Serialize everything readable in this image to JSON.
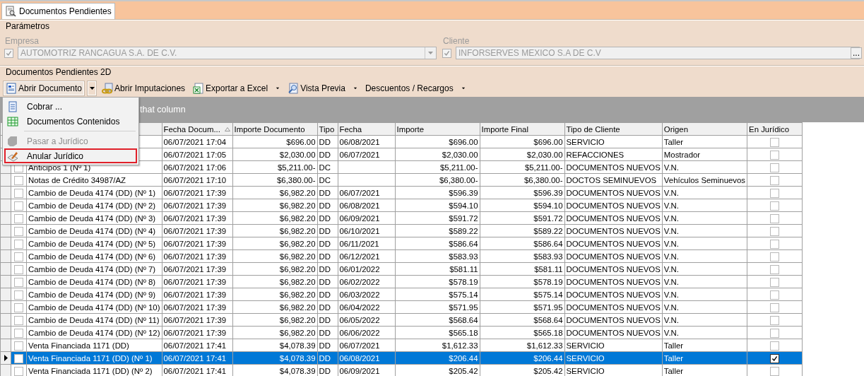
{
  "tab": {
    "title": "Documentos Pendientes",
    "selected": true
  },
  "parametros": {
    "title": "Parámetros",
    "empresa": {
      "label": "Empresa",
      "checked": true,
      "disabled": true,
      "value": "AUTOMOTRIZ RANCAGUA S.A. DE C.V."
    },
    "cliente": {
      "label": "Cliente",
      "checked": true,
      "disabled": true,
      "value": "INFORSERVES MEXICO S.A DE C.V",
      "browse_button": "..."
    }
  },
  "section_title": "Documentos Pendientes 2D",
  "toolbar": [
    {
      "kind": "doc",
      "label": "Abrir Documento",
      "split": true,
      "pressed": true
    },
    {
      "kind": "link",
      "label": "Abrir Imputaciones",
      "split": false,
      "pressed": false
    },
    {
      "kind": "excel",
      "label": "Exportar a Excel",
      "dropdown": true,
      "pressed": false
    },
    {
      "kind": "preview",
      "label": "Vista Previa",
      "dropdown": true,
      "pressed": false
    },
    {
      "kind": "none",
      "label": "Descuentos / Recargos",
      "dropdown": true,
      "pressed": false
    }
  ],
  "menu": [
    {
      "kind": "page",
      "label": "Cobrar ...",
      "disabled": false,
      "outlined": false
    },
    {
      "kind": "grid",
      "label": "Documentos Contenidos",
      "disabled": false,
      "outlined": false
    },
    {
      "kind": "separator"
    },
    {
      "kind": "tag",
      "label": "Pasar a Jurídico",
      "disabled": true,
      "outlined": false
    },
    {
      "kind": "pen",
      "label": "Anular Jurídico",
      "disabled": false,
      "outlined": true
    }
  ],
  "group_panel": "that column",
  "columns": [
    {
      "title": "Fecha Docum...",
      "sort_ascending": true
    },
    {
      "title": "Importe Documento"
    },
    {
      "title": "Tipo"
    },
    {
      "title": "Fecha"
    },
    {
      "title": "Importe"
    },
    {
      "title": "Importe Final"
    },
    {
      "title": "Tipo de Cliente"
    },
    {
      "title": "Origen"
    },
    {
      "title": "En Jurídico"
    }
  ],
  "rows": [
    {
      "fecha_documento": "06/07/2021 17:04",
      "importe_documento": "$696.00",
      "tipo": "DD",
      "fecha": "06/08/2021",
      "importe": "$696.00",
      "importe_final": "$696.00",
      "tipo_cliente": "SERVICIO",
      "origen": "Taller",
      "en_juridico": false,
      "selected": false
    },
    {
      "fecha_documento": "06/07/2021 17:05",
      "importe_documento": "$2,030.00",
      "tipo": "DD",
      "fecha": "06/07/2021",
      "importe": "$2,030.00",
      "importe_final": "$2,030.00",
      "tipo_cliente": "REFACCIONES",
      "origen": "Mostrador",
      "en_juridico": false,
      "selected": false
    },
    {
      "documento": "Anticipos 1 (Nº 1)",
      "checked": false,
      "fecha_documento": "06/07/2021 17:06",
      "importe_documento": "$5,211.00-",
      "tipo": "DC",
      "importe": "$5,211.00-",
      "importe_final": "$5,211.00-",
      "tipo_cliente": "DOCUMENTOS NUEVOS",
      "origen": "V.N.",
      "en_juridico": false,
      "selected": false
    },
    {
      "documento": "Notas de Crédito 34987/AZ",
      "checked": false,
      "fecha_documento": "06/07/2021 17:10",
      "importe_documento": "$6,380.00-",
      "tipo": "DC",
      "importe": "$6,380.00-",
      "importe_final": "$6,380.00-",
      "tipo_cliente": "DOCTOS SEMINUEVOS",
      "origen": "Vehículos Seminuevos",
      "en_juridico": false,
      "selected": false
    },
    {
      "documento": "Cambio de Deuda 4174 (DD) (Nº 1)",
      "checked": false,
      "fecha_documento": "06/07/2021 17:39",
      "importe_documento": "$6,982.20",
      "tipo": "DD",
      "fecha": "06/07/2021",
      "importe": "$596.39",
      "importe_final": "$596.39",
      "tipo_cliente": "DOCUMENTOS NUEVOS",
      "origen": "V.N.",
      "en_juridico": false,
      "selected": false
    },
    {
      "documento": "Cambio de Deuda 4174 (DD) (Nº 2)",
      "checked": false,
      "fecha_documento": "06/07/2021 17:39",
      "importe_documento": "$6,982.20",
      "tipo": "DD",
      "fecha": "06/08/2021",
      "importe": "$594.10",
      "importe_final": "$594.10",
      "tipo_cliente": "DOCUMENTOS NUEVOS",
      "origen": "V.N.",
      "en_juridico": false,
      "selected": false
    },
    {
      "documento": "Cambio de Deuda 4174 (DD) (Nº 3)",
      "checked": false,
      "fecha_documento": "06/07/2021 17:39",
      "importe_documento": "$6,982.20",
      "tipo": "DD",
      "fecha": "06/09/2021",
      "importe": "$591.72",
      "importe_final": "$591.72",
      "tipo_cliente": "DOCUMENTOS NUEVOS",
      "origen": "V.N.",
      "en_juridico": false,
      "selected": false
    },
    {
      "documento": "Cambio de Deuda 4174 (DD) (Nº 4)",
      "checked": false,
      "fecha_documento": "06/07/2021 17:39",
      "importe_documento": "$6,982.20",
      "tipo": "DD",
      "fecha": "06/10/2021",
      "importe": "$589.22",
      "importe_final": "$589.22",
      "tipo_cliente": "DOCUMENTOS NUEVOS",
      "origen": "V.N.",
      "en_juridico": false,
      "selected": false
    },
    {
      "documento": "Cambio de Deuda 4174 (DD) (Nº 5)",
      "checked": false,
      "fecha_documento": "06/07/2021 17:39",
      "importe_documento": "$6,982.20",
      "tipo": "DD",
      "fecha": "06/11/2021",
      "importe": "$586.64",
      "importe_final": "$586.64",
      "tipo_cliente": "DOCUMENTOS NUEVOS",
      "origen": "V.N.",
      "en_juridico": false,
      "selected": false
    },
    {
      "documento": "Cambio de Deuda 4174 (DD) (Nº 6)",
      "checked": false,
      "fecha_documento": "06/07/2021 17:39",
      "importe_documento": "$6,982.20",
      "tipo": "DD",
      "fecha": "06/12/2021",
      "importe": "$583.93",
      "importe_final": "$583.93",
      "tipo_cliente": "DOCUMENTOS NUEVOS",
      "origen": "V.N.",
      "en_juridico": false,
      "selected": false
    },
    {
      "documento": "Cambio de Deuda 4174 (DD) (Nº 7)",
      "checked": false,
      "fecha_documento": "06/07/2021 17:39",
      "importe_documento": "$6,982.20",
      "tipo": "DD",
      "fecha": "06/01/2022",
      "importe": "$581.11",
      "importe_final": "$581.11",
      "tipo_cliente": "DOCUMENTOS NUEVOS",
      "origen": "V.N.",
      "en_juridico": false,
      "selected": false
    },
    {
      "documento": "Cambio de Deuda 4174 (DD) (Nº 8)",
      "checked": false,
      "fecha_documento": "06/07/2021 17:39",
      "importe_documento": "$6,982.20",
      "tipo": "DD",
      "fecha": "06/02/2022",
      "importe": "$578.19",
      "importe_final": "$578.19",
      "tipo_cliente": "DOCUMENTOS NUEVOS",
      "origen": "V.N.",
      "en_juridico": false,
      "selected": false
    },
    {
      "documento": "Cambio de Deuda 4174 (DD) (Nº 9)",
      "checked": false,
      "fecha_documento": "06/07/2021 17:39",
      "importe_documento": "$6,982.20",
      "tipo": "DD",
      "fecha": "06/03/2022",
      "importe": "$575.14",
      "importe_final": "$575.14",
      "tipo_cliente": "DOCUMENTOS NUEVOS",
      "origen": "V.N.",
      "en_juridico": false,
      "selected": false
    },
    {
      "documento": "Cambio de Deuda 4174 (DD) (Nº 10)",
      "checked": false,
      "fecha_documento": "06/07/2021 17:39",
      "importe_documento": "$6,982.20",
      "tipo": "DD",
      "fecha": "06/04/2022",
      "importe": "$571.95",
      "importe_final": "$571.95",
      "tipo_cliente": "DOCUMENTOS NUEVOS",
      "origen": "V.N.",
      "en_juridico": false,
      "selected": false
    },
    {
      "documento": "Cambio de Deuda 4174 (DD) (Nº 11)",
      "checked": false,
      "fecha_documento": "06/07/2021 17:39",
      "importe_documento": "$6,982.20",
      "tipo": "DD",
      "fecha": "06/05/2022",
      "importe": "$568.64",
      "importe_final": "$568.64",
      "tipo_cliente": "DOCUMENTOS NUEVOS",
      "origen": "V.N.",
      "en_juridico": false,
      "selected": false
    },
    {
      "documento": "Cambio de Deuda 4174 (DD) (Nº 12)",
      "checked": false,
      "fecha_documento": "06/07/2021 17:39",
      "importe_documento": "$6,982.20",
      "tipo": "DD",
      "fecha": "06/06/2022",
      "importe": "$565.18",
      "importe_final": "$565.18",
      "tipo_cliente": "DOCUMENTOS NUEVOS",
      "origen": "V.N.",
      "en_juridico": false,
      "selected": false
    },
    {
      "documento": "Venta Financiada 1171 (DD)",
      "checked": false,
      "fecha_documento": "06/07/2021 17:41",
      "importe_documento": "$4,078.39",
      "tipo": "DD",
      "fecha": "06/07/2021",
      "importe": "$1,612.33",
      "importe_final": "$1,612.33",
      "tipo_cliente": "SERVICIO",
      "origen": "Taller",
      "en_juridico": false,
      "selected": false
    },
    {
      "documento": "Venta Financiada 1171 (DD) (Nº 1)",
      "checked": false,
      "fecha_documento": "06/07/2021 17:41",
      "importe_documento": "$4,078.39",
      "tipo": "DD",
      "fecha": "06/08/2021",
      "importe": "$206.44",
      "importe_final": "$206.44",
      "tipo_cliente": "SERVICIO",
      "origen": "Taller",
      "en_juridico": true,
      "selected": true
    },
    {
      "documento": "Venta Financiada 1171 (DD) (Nº 2)",
      "checked": false,
      "fecha_documento": "06/07/2021 17:41",
      "importe_documento": "$4,078.39",
      "tipo": "DD",
      "fecha": "06/09/2021",
      "importe": "$205.42",
      "importe_final": "$205.42",
      "tipo_cliente": "SERVICIO",
      "origen": "Taller",
      "en_juridico": false,
      "selected": false
    }
  ]
}
